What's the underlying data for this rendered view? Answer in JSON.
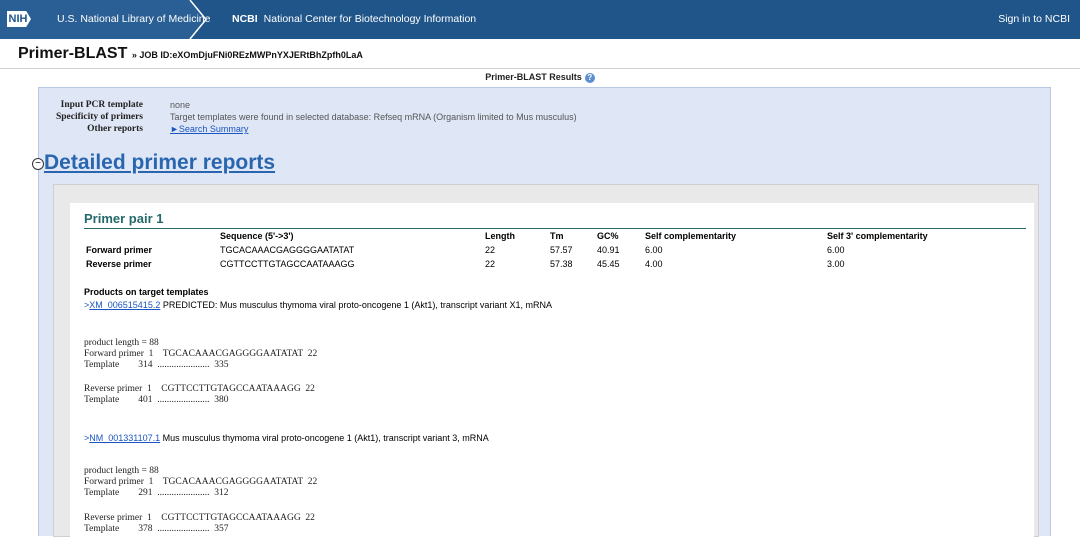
{
  "header": {
    "nih_logo": "NIH",
    "nlm": "U.S. National Library of Medicine",
    "ncbi_short": "NCBI",
    "ncbi_long": "National Center for Biotechnology Information",
    "signin": "Sign in to NCBI"
  },
  "title": {
    "app": "Primer-BLAST",
    "job": "» JOB ID:eXOmDjuFNi0REzMWPnYXJERtBhZpfh0LaA"
  },
  "results_heading": "Primer-BLAST Results",
  "info": {
    "rows": [
      {
        "label": "Input PCR template",
        "value": "none"
      },
      {
        "label": "Specificity of primers",
        "value": "Target templates were found in selected database: Refseq mRNA (Organism limited to Mus musculus)"
      },
      {
        "label": "Other reports",
        "value": "►Search Summary"
      }
    ]
  },
  "detailed_title": "Detailed primer reports",
  "primer_pair": {
    "title": "Primer pair 1",
    "headers": [
      "Sequence (5'->3')",
      "Length",
      "Tm",
      "GC%",
      "Self complementarity",
      "Self 3' complementarity"
    ],
    "rows": [
      {
        "name": "Forward primer",
        "seq": "TGCACAAACGAGGGGAATATAT",
        "len": "22",
        "tm": "57.57",
        "gc": "40.91",
        "self": "6.00",
        "self3": "6.00"
      },
      {
        "name": "Reverse primer",
        "seq": "CGTTCCTTGTAGCCAATAAAGG",
        "len": "22",
        "tm": "57.38",
        "gc": "45.45",
        "self": "4.00",
        "self3": "3.00"
      }
    ]
  },
  "products": {
    "heading": "Products on target templates",
    "items": [
      {
        "prefix": ">",
        "accession": "XM_006515415.2",
        "desc": " PREDICTED: Mus musculus thymoma viral proto-oncogene 1 (Akt1), transcript variant X1, mRNA",
        "block1": "product length = 88\nForward primer  1    TGCACAAACGAGGGGAATATAT  22\nTemplate        314  ......................  335",
        "block2": "Reverse primer  1    CGTTCCTTGTAGCCAATAAAGG  22\nTemplate        401  ......................  380"
      },
      {
        "prefix": ">",
        "accession": "NM_001331107.1",
        "desc": " Mus musculus thymoma viral proto-oncogene 1 (Akt1), transcript variant 3, mRNA",
        "block1": "product length = 88\nForward primer  1    TGCACAAACGAGGGGAATATAT  22\nTemplate        291  ......................  312",
        "block2": "Reverse primer  1    CGTTCCTTGTAGCCAATAAAGG  22\nTemplate        378  ......................  357"
      }
    ]
  },
  "colors": {
    "header_bg": "#20558a",
    "panel_bg": "#dfe7f6",
    "link": "#1a55c0",
    "section_title": "#256a6a"
  }
}
